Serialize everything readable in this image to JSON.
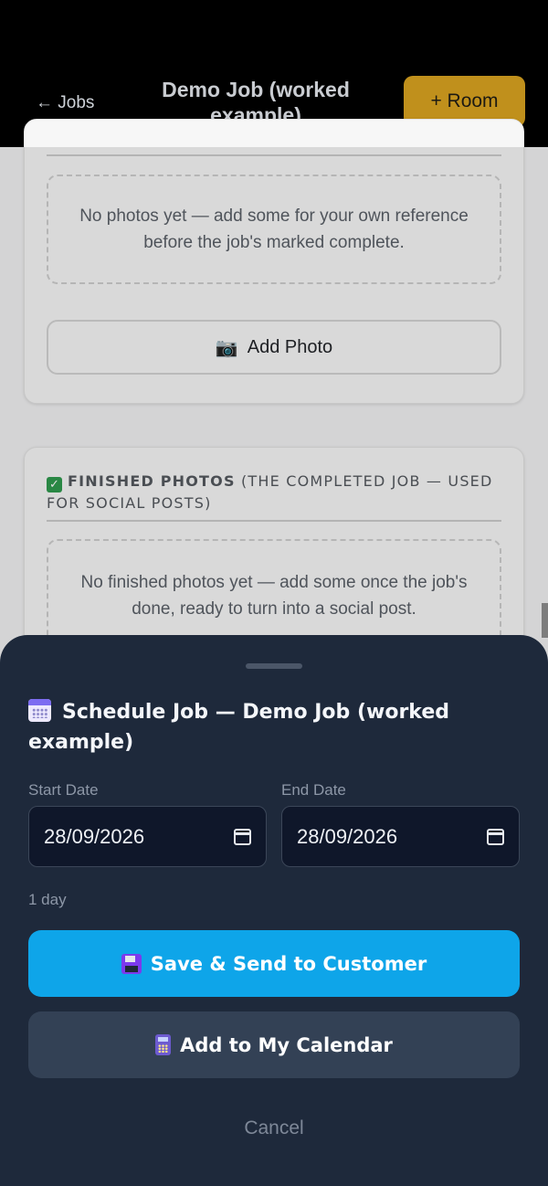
{
  "header": {
    "back_label": "← Jobs",
    "title": "Demo Job (worked example)",
    "room_button_label": "+ Room"
  },
  "photos_card": {
    "empty_text": "No photos yet — add some for your own reference before the job's marked complete.",
    "add_photo_label": "Add Photo",
    "add_photo_icon": "camera-icon"
  },
  "finished_card": {
    "heading": "FINISHED PHOTOS",
    "heading_note": "(THE COMPLETED JOB — USED FOR SOCIAL POSTS)",
    "heading_icon": "check-mark-icon",
    "empty_text": "No finished photos yet — add some once the job's done, ready to turn into a social post."
  },
  "schedule_sheet": {
    "title": "Schedule Job — Demo Job (worked example)",
    "title_icon": "calendar-icon",
    "start_label": "Start Date",
    "start_value": "28/09/2026",
    "end_label": "End Date",
    "end_value": "28/09/2026",
    "duration": "1 day",
    "save_send_label": "Save & Send to Customer",
    "add_calendar_label": "Add to My Calendar",
    "cancel_label": "Cancel"
  },
  "colors": {
    "sheet_bg": "#1e293b",
    "primary": "#0ea5e9",
    "secondary": "#334155",
    "accent": "#c0901c"
  }
}
